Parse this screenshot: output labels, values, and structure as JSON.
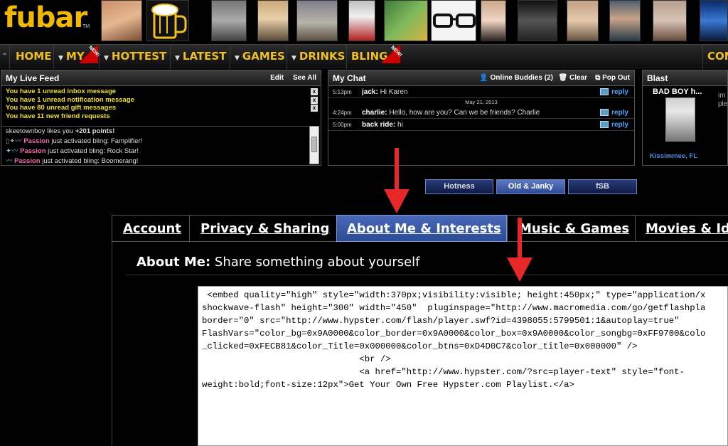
{
  "logo": {
    "text": "fubar",
    "tm": "TM"
  },
  "nav": {
    "items": [
      {
        "label": "HOME",
        "caret": false
      },
      {
        "label": "MY",
        "caret": true
      },
      {
        "label": "HOTTEST",
        "caret": true
      },
      {
        "label": "LATEST",
        "caret": true
      },
      {
        "label": "GAMES",
        "caret": true
      },
      {
        "label": "DRINKS",
        "caret": true
      },
      {
        "label": "BLING",
        "caret": false
      },
      {
        "label": "CON",
        "caret": false
      }
    ],
    "new_badge": "NEW!"
  },
  "live_feed": {
    "title": "My Live Feed",
    "edit": "Edit",
    "see_all": "See All",
    "messages": [
      "You have 1 unread inbox message",
      "You have 1 unread notification message",
      "You have 80 unread gift messages",
      "You have 11 new friend requests"
    ],
    "dismiss": "x",
    "items": [
      {
        "name": "skeetownboy",
        "text": " likes you ",
        "extra": "+201 points!"
      },
      {
        "name": "Passion",
        "text": " just activated bling: Famplifier!",
        "extra": ""
      },
      {
        "name": "Passion",
        "text": " just activated bling: Rock Star!",
        "extra": ""
      },
      {
        "name": "Passion",
        "text": " just activated bling: Boomerang!",
        "extra": ""
      }
    ]
  },
  "chat": {
    "title": "My Chat",
    "online": "Online Buddies (2)",
    "clear": "Clear",
    "popout": "Pop Out",
    "rows": [
      {
        "time": "5:13pm",
        "user": "jack:",
        "msg": " Hi Karen"
      },
      {
        "time": "4:24pm",
        "user": "charlie:",
        "msg": " Hello, how are you? Can we be friends? Charlie"
      },
      {
        "time": "5:00pm",
        "user": "back ride:",
        "msg": " hi"
      }
    ],
    "date": "May 21, 2013",
    "reply": "reply"
  },
  "blast": {
    "title": "Blast",
    "name": "BAD BOY h...",
    "extra": "im\nple",
    "location": "Kissimmee, FL"
  },
  "themes": [
    {
      "label": "Hotness",
      "active": false
    },
    {
      "label": "Old & Janky",
      "active": true
    },
    {
      "label": "fSB",
      "active": false
    }
  ],
  "tabs": [
    {
      "label": "Account",
      "active": false
    },
    {
      "label": "Privacy & Sharing",
      "active": false
    },
    {
      "label": "About Me & Interests",
      "active": true
    },
    {
      "label": "Music & Games",
      "active": false
    },
    {
      "label": "Movies & Id",
      "active": false
    }
  ],
  "about": {
    "label": "About Me:",
    "subtitle": " Share something about yourself"
  },
  "code": " <embed quality=\"high\" style=\"width:370px;visibility:visible; height:450px;\" type=\"application/x\nshockwave-flash\" height=\"300\" width=\"450\"  pluginspage=\"http://www.macromedia.com/go/getflashpla\nborder=\"0\" src=\"http://www.hypster.com/flash/player.swf?id=4398055:5799501:1&autoplay=true\"\nFlashVars=\"color_bg=0x9A0000&color_border=0x9A0000&color_box=0x9A0000&color_songbg=0xFF9700&colo\n_clicked=0xFECB81&color_Title=0x000000&color_btns=0xD4D0C7&color_title=0x000000\" />\n                              <br />\n                              <a href=\"http://www.hypster.com/?src=player-text\" style=\"font-\nweight:bold;font-size:12px\">Get Your Own Free Hypster.com Playlist.</a>",
  "colors": {
    "accent": "#f0c020",
    "tab_active": "#3a5aa8",
    "arrow": "#e82828",
    "link": "#4aa8ff"
  }
}
